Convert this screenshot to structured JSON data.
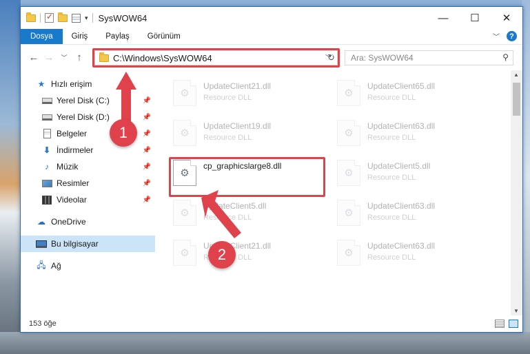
{
  "window": {
    "title": "SysWOW64"
  },
  "ribbon": {
    "tabs": [
      "Dosya",
      "Giriş",
      "Paylaş",
      "Görünüm"
    ]
  },
  "address": {
    "path": "C:\\Windows\\SysWOW64"
  },
  "search": {
    "placeholder": "Ara: SysWOW64"
  },
  "sidebar": {
    "items": [
      {
        "label": "Hızlı erişim",
        "icon": "star-icon"
      },
      {
        "label": "Yerel Disk (C:)",
        "icon": "drive-icon"
      },
      {
        "label": "Yerel Disk (D:)",
        "icon": "drive-icon"
      },
      {
        "label": "Belgeler",
        "icon": "document-icon"
      },
      {
        "label": "İndirmeler",
        "icon": "download-icon"
      },
      {
        "label": "Müzik",
        "icon": "music-icon"
      },
      {
        "label": "Resimler",
        "icon": "pictures-icon"
      },
      {
        "label": "Videolar",
        "icon": "videos-icon"
      },
      {
        "label": "OneDrive",
        "icon": "cloud-icon"
      },
      {
        "label": "Bu bilgisayar",
        "icon": "computer-icon"
      },
      {
        "label": "Ağ",
        "icon": "network-icon"
      }
    ]
  },
  "files": {
    "col1": [
      {
        "name": "UpdateClient21.dll",
        "desc": "Resource DLL"
      },
      {
        "name": "UpdateClient19.dll",
        "desc": "Resource DLL"
      },
      {
        "name": "cp_graphicslarge8.dll",
        "desc": ""
      },
      {
        "name": "UpdateClient5.dll",
        "desc": "Resource DLL"
      },
      {
        "name": "UpdateClient21.dll",
        "desc": "Resource DLL"
      }
    ],
    "col2": [
      {
        "name": "UpdateClient65.dll",
        "desc": "Resource DLL"
      },
      {
        "name": "UpdateClient63.dll",
        "desc": "Resource DLL"
      },
      {
        "name": "UpdateClient5.dll",
        "desc": "Resource DLL"
      },
      {
        "name": "UpdateClient63.dll",
        "desc": "Resource DLL"
      },
      {
        "name": "UpdateClient63.dll",
        "desc": "Resource DLL"
      }
    ]
  },
  "status": {
    "count": "153 öğe"
  },
  "steps": {
    "one": "1",
    "two": "2"
  },
  "colors": {
    "accent": "#1979ca",
    "highlight": "#e0424c"
  }
}
